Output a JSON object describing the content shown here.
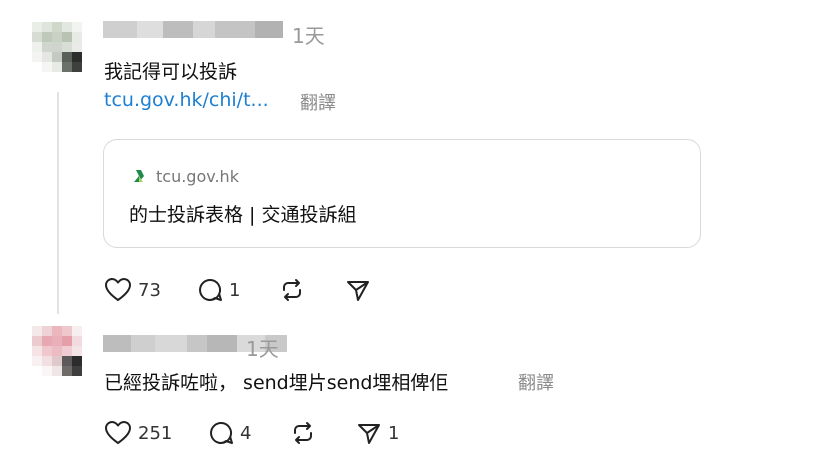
{
  "post1": {
    "time": "1天",
    "text": "我記得可以投訴",
    "link": "tcu.gov.hk/chi/t...",
    "translate": "翻譯",
    "card": {
      "domain": "tcu.gov.hk",
      "title": "的士投訴表格 | 交通投訴組"
    },
    "likes": "73",
    "replies": "1",
    "shares": ""
  },
  "post2": {
    "time": "1天",
    "text": "已經投訴咗啦， send埋片send埋相俾佢",
    "translate": "翻譯",
    "likes": "251",
    "replies": "4",
    "shares": "1"
  },
  "colors": {
    "link": "#1d7fd1",
    "logo_green": "#1f8a4c",
    "muted": "#9a9a9a"
  },
  "icons": [
    "heart-icon",
    "comment-icon",
    "repost-icon",
    "share-icon",
    "site-logo-icon"
  ]
}
